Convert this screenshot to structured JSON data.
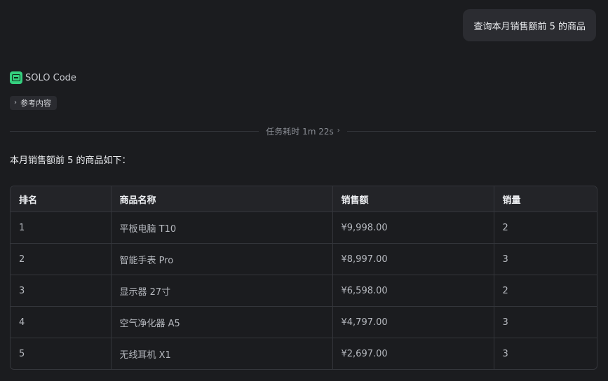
{
  "user_message": "查询本月销售额前 5 的商品",
  "assistant": {
    "name": "SOLO Code",
    "logo_icon": "solo-code-logo-icon",
    "reference_chip": "参考内容",
    "task_time_label": "任务耗时 1m 22s",
    "intro": "本月销售额前 5 的商品如下："
  },
  "table": {
    "headers": [
      "排名",
      "商品名称",
      "销售额",
      "销量"
    ],
    "rows": [
      [
        "1",
        "平板电脑 T10",
        "¥9,998.00",
        "2"
      ],
      [
        "2",
        "智能手表 Pro",
        "¥8,997.00",
        "3"
      ],
      [
        "3",
        "显示器 27寸",
        "¥6,598.00",
        "2"
      ],
      [
        "4",
        "空气净化器 A5",
        "¥4,797.00",
        "3"
      ],
      [
        "5",
        "无线耳机 X1",
        "¥2,697.00",
        "3"
      ]
    ]
  },
  "colors": {
    "background": "#1b1c1f",
    "bubble": "#2b2c31",
    "accent_green": "#35d07f",
    "border": "#34363b"
  }
}
